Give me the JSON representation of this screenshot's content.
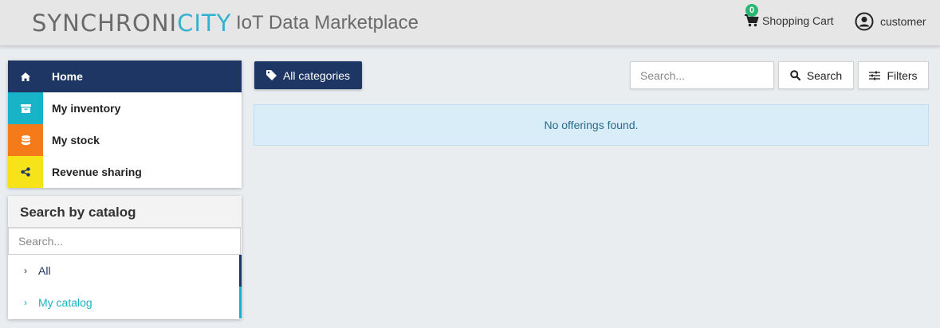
{
  "header": {
    "logo_part1": "SYNCHRONI",
    "logo_part2": "CITY",
    "app_title": "IoT Data Marketplace",
    "cart_count": "0",
    "cart_label": "Shopping Cart",
    "user_label": "customer"
  },
  "menu": {
    "items": [
      {
        "label": "Home",
        "icon": "home-icon"
      },
      {
        "label": "My inventory",
        "icon": "archive-icon"
      },
      {
        "label": "My stock",
        "icon": "database-icon"
      },
      {
        "label": "Revenue sharing",
        "icon": "share-icon"
      }
    ]
  },
  "catalog": {
    "title": "Search by catalog",
    "search_placeholder": "Search...",
    "items": [
      {
        "label": "All"
      },
      {
        "label": "My catalog"
      }
    ]
  },
  "toolbar": {
    "categories_label": "All categories",
    "search_placeholder": "Search...",
    "search_label": "Search",
    "filters_label": "Filters"
  },
  "main": {
    "empty_message": "No offerings found."
  },
  "colors": {
    "navy": "#1e3664",
    "teal": "#18b3c7",
    "orange": "#f47a1a",
    "yellow": "#f6e31a",
    "badge_green": "#2bb673",
    "logo_accent": "#33b1cf"
  }
}
